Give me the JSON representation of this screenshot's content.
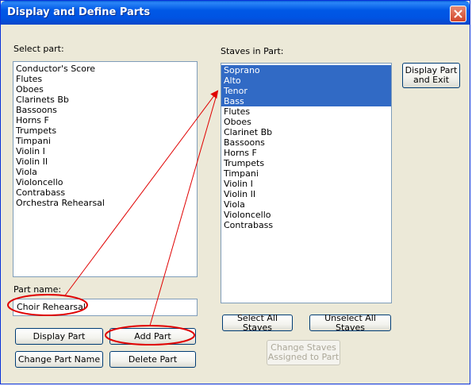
{
  "window": {
    "title": "Display and Define Parts"
  },
  "select_part": {
    "label": "Select part:",
    "items": [
      "Conductor's Score",
      "Flutes",
      "Oboes",
      "Clarinets Bb",
      "Bassoons",
      "Horns F",
      "Trumpets",
      "Timpani",
      "Violin I",
      "Violin II",
      "Viola",
      "Violoncello",
      "Contrabass",
      "Orchestra Rehearsal"
    ]
  },
  "part_name": {
    "label": "Part name:",
    "value": "Choir Rehearsal"
  },
  "buttons": {
    "display_part": "Display Part",
    "add_part": "Add Part",
    "change_part_name": "Change Part Name",
    "delete_part": "Delete Part",
    "display_part_exit": "Display Part and Exit",
    "select_all": "Select All Staves",
    "unselect_all": "Unselect All Staves",
    "change_staves": "Change Staves Assigned to Part"
  },
  "staves": {
    "label": "Staves in Part:",
    "items": [
      "Soprano",
      "Alto",
      "Tenor",
      "Bass",
      "Flutes",
      "Oboes",
      "Clarinet Bb",
      "Bassoons",
      "Horns F",
      "Trumpets",
      "Timpani",
      "Violin I",
      "Violin II",
      "Viola",
      "Violoncello",
      "Contrabass"
    ],
    "selected": [
      "Soprano",
      "Alto",
      "Tenor",
      "Bass"
    ]
  },
  "colors": {
    "titlebar": "#0054e3",
    "selection": "#316ac5",
    "annotation": "#e00000"
  }
}
